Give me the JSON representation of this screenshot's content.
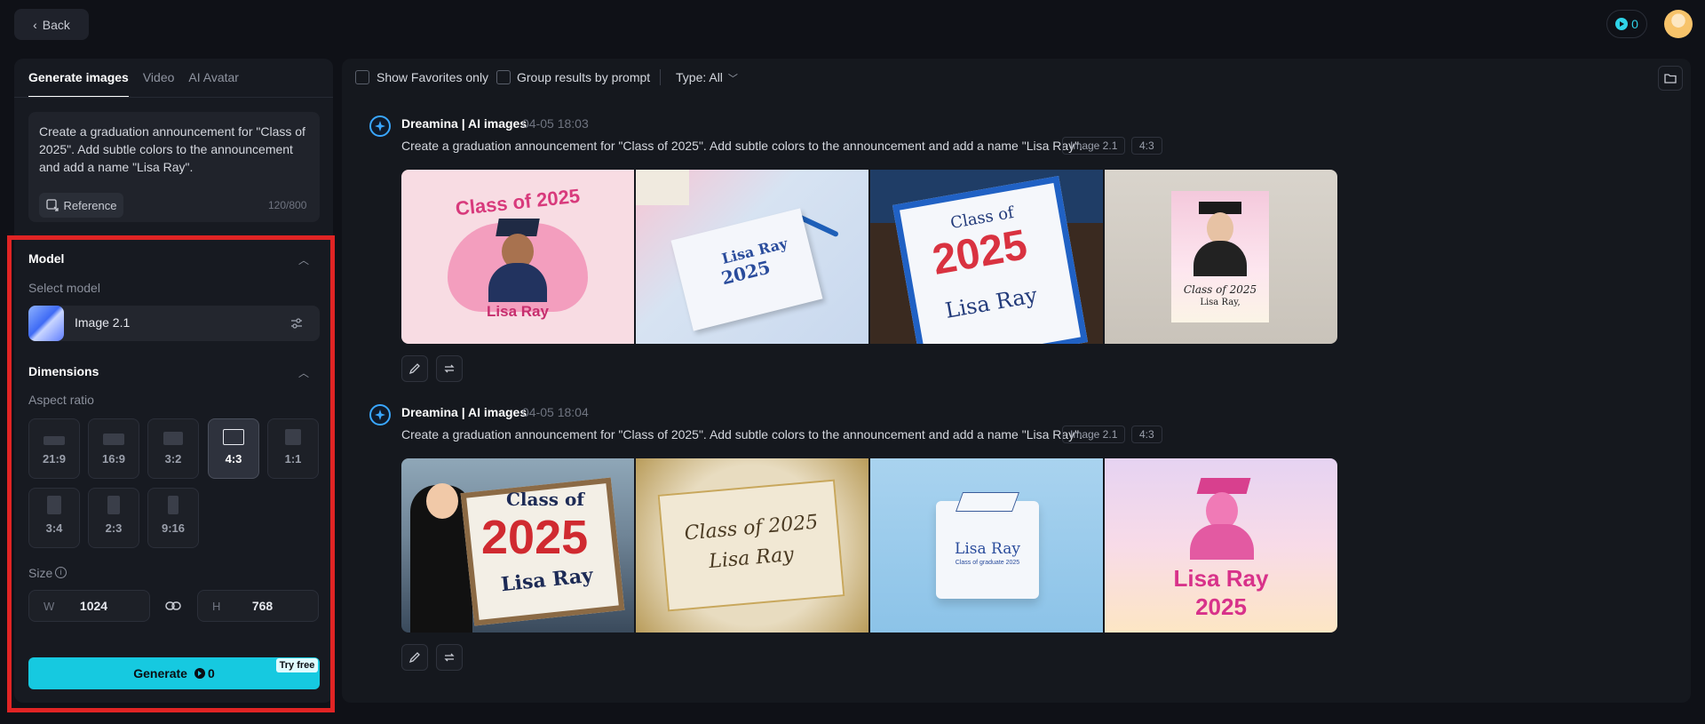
{
  "topbar": {
    "back_label": "Back",
    "credits": "0"
  },
  "left": {
    "tabs": [
      {
        "label": "Generate images",
        "active": true
      },
      {
        "label": "Video",
        "active": false
      },
      {
        "label": "AI Avatar",
        "active": false
      }
    ],
    "prompt": "Create a graduation announcement for \"Class of 2025\".  Add subtle colors to the announcement and add a name \"Lisa Ray\".",
    "reference_label": "Reference",
    "char_count": "120/800",
    "model_section": {
      "title": "Model",
      "select_label": "Select model",
      "selected_model": "Image 2.1"
    },
    "dimensions_section": {
      "title": "Dimensions",
      "aspect_label": "Aspect ratio",
      "ratios": [
        "21:9",
        "16:9",
        "3:2",
        "4:3",
        "1:1",
        "3:4",
        "2:3",
        "9:16"
      ],
      "selected_ratio": "4:3",
      "size_label": "Size",
      "width_prefix": "W",
      "width": "1024",
      "height_prefix": "H",
      "height": "768"
    },
    "generate": {
      "label": "Generate",
      "cost": "0",
      "badge": "Try free"
    }
  },
  "right": {
    "filters": {
      "favorites_label": "Show Favorites only",
      "group_label": "Group results by prompt",
      "type_label": "Type: All"
    },
    "generations": [
      {
        "source": "Dreamina | AI images",
        "time": "04-05  18:03",
        "prompt": "Create a graduation announcement for \"Class of 2025\". Add subtle colors to the announcement and add a name \"Lisa Ray\".",
        "tags": [
          "Image 2.1",
          "4:3"
        ],
        "images": [
          {
            "line1": "Class of 2025",
            "line2": "Lisa Ray"
          },
          {
            "line1": "Lisa Ray",
            "line2": "2025"
          },
          {
            "line1": "Class of",
            "line2": "2025",
            "line3": "Lisa Ray"
          },
          {
            "line1": "Class of 2025",
            "line2": "Lisa Ray,"
          }
        ]
      },
      {
        "source": "Dreamina | AI images",
        "time": "04-05  18:04",
        "prompt": "Create a graduation announcement for \"Class of 2025\". Add subtle colors to the announcement and add a name \"Lisa Ray\".",
        "tags": [
          "Image 2.1",
          "4:3"
        ],
        "images": [
          {
            "line1": "Class of",
            "line2": "2025",
            "line3": "Lisa Ray"
          },
          {
            "line1": "Class of 2025",
            "line2": "Lisa Ray"
          },
          {
            "line1": "Lisa Ray",
            "line2": "Class of graduate 2025"
          },
          {
            "line1": "Lisa Ray",
            "line2": "2025"
          }
        ]
      }
    ]
  }
}
